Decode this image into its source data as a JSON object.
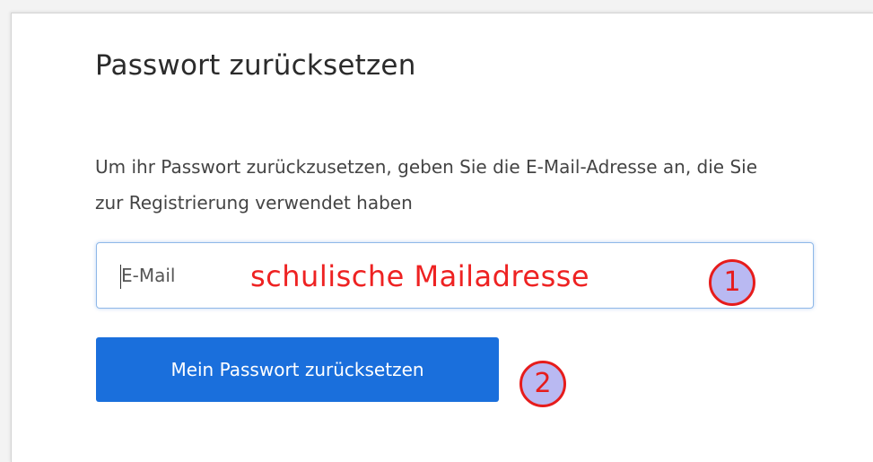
{
  "form": {
    "title": "Passwort zurücksetzen",
    "description": "Um ihr Passwort zurückzusetzen, geben Sie die E-Mail-Adresse an, die Sie zur Registrierung verwendet haben",
    "email_placeholder": "E-Mail",
    "email_value": "",
    "submit_label": "Mein Passwort zurücksetzen"
  },
  "annotations": {
    "input_hint": "schulische Mailadresse",
    "step1": "1",
    "step2": "2",
    "color": "#ee2222",
    "badge_fill": "#b9b9f2"
  },
  "colors": {
    "button_bg": "#1a6fdc",
    "input_focus_border": "#8fb8e8"
  }
}
